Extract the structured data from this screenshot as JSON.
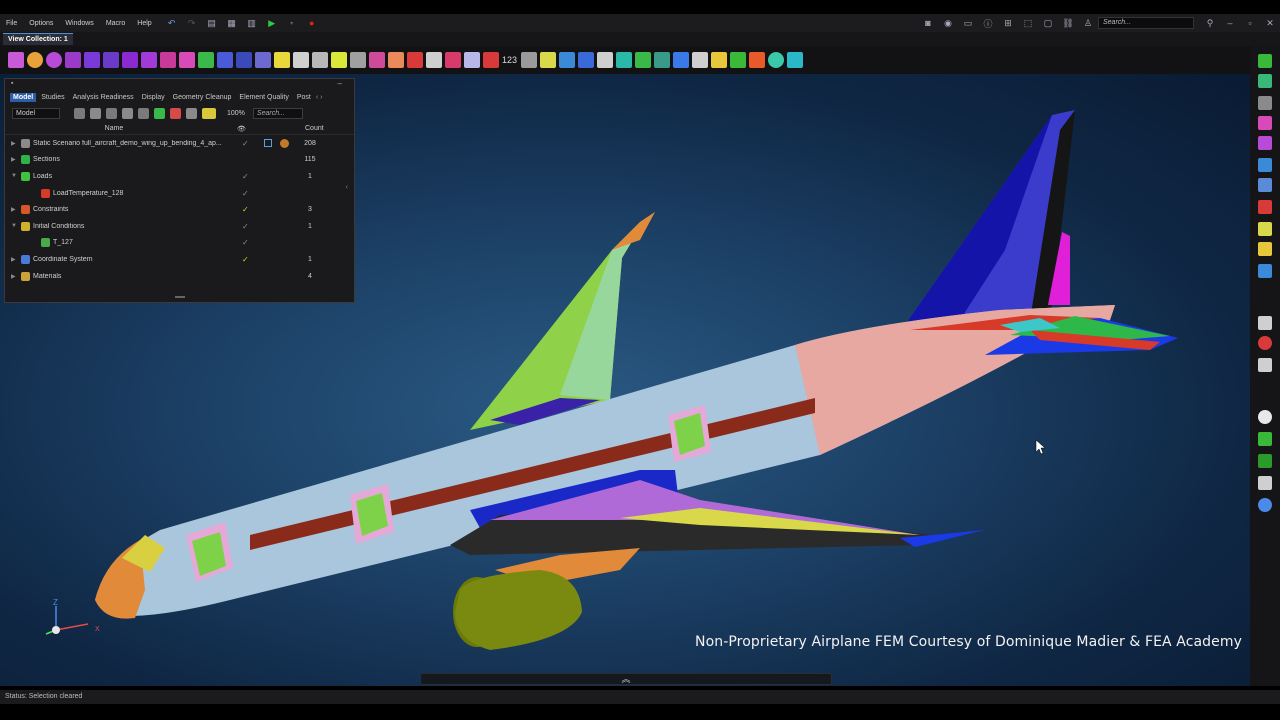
{
  "menu": {
    "items": [
      "File",
      "Options",
      "Windows",
      "Macro",
      "Help"
    ],
    "search_placeholder": "Search..."
  },
  "view_collection": {
    "tab_label": "View Collection: 1"
  },
  "toolbar": {
    "counter_label": "123"
  },
  "panel": {
    "tabs": [
      "Model",
      "Studies",
      "Analysis Readiness",
      "Display",
      "Geometry Cleanup",
      "Element Quality",
      "Post"
    ],
    "active_tab": "Model",
    "mode_select": "Model",
    "zoom": "100%",
    "search_placeholder": "Search...",
    "columns": {
      "name": "Name",
      "count": "Count"
    },
    "rows": [
      {
        "label": "Static Scenario full_aircraft_demo_wing_up_bending_4_ap...",
        "count": "208",
        "expanded": false,
        "check": "full",
        "indent": 0,
        "icon_color": "#8a8a8a"
      },
      {
        "label": "Sections",
        "count": "115",
        "expanded": false,
        "check": "",
        "indent": 0,
        "icon_color": "#2fb24a"
      },
      {
        "label": "Loads",
        "count": "1",
        "expanded": true,
        "check": "full",
        "indent": 0,
        "icon_color": "#3ec43e"
      },
      {
        "label": "LoadTemperature_128",
        "count": "",
        "expanded": false,
        "check": "full",
        "indent": 1,
        "icon_color": "#d83a2a"
      },
      {
        "label": "Constraints",
        "count": "3",
        "expanded": false,
        "check": "partial",
        "indent": 0,
        "icon_color": "#d8572a"
      },
      {
        "label": "Initial Conditions",
        "count": "1",
        "expanded": true,
        "check": "full",
        "indent": 0,
        "icon_color": "#d0b22a"
      },
      {
        "label": "T_127",
        "count": "",
        "expanded": false,
        "check": "full",
        "indent": 1,
        "icon_color": "#4aaa4a"
      },
      {
        "label": "Coordinate System",
        "count": "1",
        "expanded": false,
        "check": "partial",
        "indent": 0,
        "icon_color": "#4a7ad8"
      },
      {
        "label": "Materials",
        "count": "4",
        "expanded": false,
        "check": "",
        "indent": 0,
        "icon_color": "#c9a23a"
      }
    ]
  },
  "viewport": {
    "courtesy_text": "Non-Proprietary Airplane FEM Courtesy of Dominique Madier & FEA Academy",
    "triad": {
      "z": "Z",
      "x": "X"
    }
  },
  "status": {
    "text": "Status:  Selection cleared"
  },
  "colors": {
    "fuselage": "#a9c6dc",
    "tail_section": "#e6a8a0",
    "vertical_fin": "#2323b8",
    "wing_green": "#8fd24a",
    "windows": "#8a2a1a",
    "nacelle": "#7a8a10",
    "nose": "#e08a3a"
  }
}
